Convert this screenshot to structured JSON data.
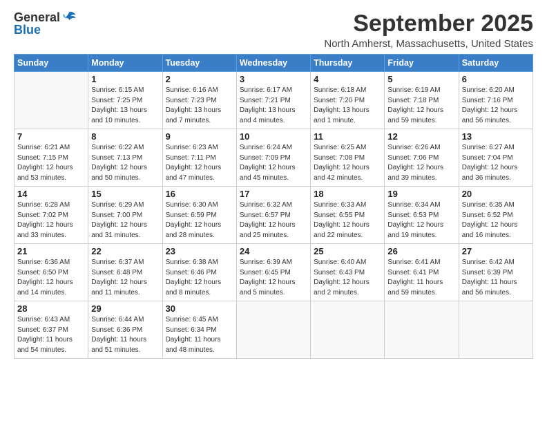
{
  "logo": {
    "general": "General",
    "blue": "Blue"
  },
  "title": "September 2025",
  "location": "North Amherst, Massachusetts, United States",
  "weekdays": [
    "Sunday",
    "Monday",
    "Tuesday",
    "Wednesday",
    "Thursday",
    "Friday",
    "Saturday"
  ],
  "weeks": [
    [
      {
        "day": "",
        "info": ""
      },
      {
        "day": "1",
        "info": "Sunrise: 6:15 AM\nSunset: 7:25 PM\nDaylight: 13 hours\nand 10 minutes."
      },
      {
        "day": "2",
        "info": "Sunrise: 6:16 AM\nSunset: 7:23 PM\nDaylight: 13 hours\nand 7 minutes."
      },
      {
        "day": "3",
        "info": "Sunrise: 6:17 AM\nSunset: 7:21 PM\nDaylight: 13 hours\nand 4 minutes."
      },
      {
        "day": "4",
        "info": "Sunrise: 6:18 AM\nSunset: 7:20 PM\nDaylight: 13 hours\nand 1 minute."
      },
      {
        "day": "5",
        "info": "Sunrise: 6:19 AM\nSunset: 7:18 PM\nDaylight: 12 hours\nand 59 minutes."
      },
      {
        "day": "6",
        "info": "Sunrise: 6:20 AM\nSunset: 7:16 PM\nDaylight: 12 hours\nand 56 minutes."
      }
    ],
    [
      {
        "day": "7",
        "info": "Sunrise: 6:21 AM\nSunset: 7:15 PM\nDaylight: 12 hours\nand 53 minutes."
      },
      {
        "day": "8",
        "info": "Sunrise: 6:22 AM\nSunset: 7:13 PM\nDaylight: 12 hours\nand 50 minutes."
      },
      {
        "day": "9",
        "info": "Sunrise: 6:23 AM\nSunset: 7:11 PM\nDaylight: 12 hours\nand 47 minutes."
      },
      {
        "day": "10",
        "info": "Sunrise: 6:24 AM\nSunset: 7:09 PM\nDaylight: 12 hours\nand 45 minutes."
      },
      {
        "day": "11",
        "info": "Sunrise: 6:25 AM\nSunset: 7:08 PM\nDaylight: 12 hours\nand 42 minutes."
      },
      {
        "day": "12",
        "info": "Sunrise: 6:26 AM\nSunset: 7:06 PM\nDaylight: 12 hours\nand 39 minutes."
      },
      {
        "day": "13",
        "info": "Sunrise: 6:27 AM\nSunset: 7:04 PM\nDaylight: 12 hours\nand 36 minutes."
      }
    ],
    [
      {
        "day": "14",
        "info": "Sunrise: 6:28 AM\nSunset: 7:02 PM\nDaylight: 12 hours\nand 33 minutes."
      },
      {
        "day": "15",
        "info": "Sunrise: 6:29 AM\nSunset: 7:00 PM\nDaylight: 12 hours\nand 31 minutes."
      },
      {
        "day": "16",
        "info": "Sunrise: 6:30 AM\nSunset: 6:59 PM\nDaylight: 12 hours\nand 28 minutes."
      },
      {
        "day": "17",
        "info": "Sunrise: 6:32 AM\nSunset: 6:57 PM\nDaylight: 12 hours\nand 25 minutes."
      },
      {
        "day": "18",
        "info": "Sunrise: 6:33 AM\nSunset: 6:55 PM\nDaylight: 12 hours\nand 22 minutes."
      },
      {
        "day": "19",
        "info": "Sunrise: 6:34 AM\nSunset: 6:53 PM\nDaylight: 12 hours\nand 19 minutes."
      },
      {
        "day": "20",
        "info": "Sunrise: 6:35 AM\nSunset: 6:52 PM\nDaylight: 12 hours\nand 16 minutes."
      }
    ],
    [
      {
        "day": "21",
        "info": "Sunrise: 6:36 AM\nSunset: 6:50 PM\nDaylight: 12 hours\nand 14 minutes."
      },
      {
        "day": "22",
        "info": "Sunrise: 6:37 AM\nSunset: 6:48 PM\nDaylight: 12 hours\nand 11 minutes."
      },
      {
        "day": "23",
        "info": "Sunrise: 6:38 AM\nSunset: 6:46 PM\nDaylight: 12 hours\nand 8 minutes."
      },
      {
        "day": "24",
        "info": "Sunrise: 6:39 AM\nSunset: 6:45 PM\nDaylight: 12 hours\nand 5 minutes."
      },
      {
        "day": "25",
        "info": "Sunrise: 6:40 AM\nSunset: 6:43 PM\nDaylight: 12 hours\nand 2 minutes."
      },
      {
        "day": "26",
        "info": "Sunrise: 6:41 AM\nSunset: 6:41 PM\nDaylight: 11 hours\nand 59 minutes."
      },
      {
        "day": "27",
        "info": "Sunrise: 6:42 AM\nSunset: 6:39 PM\nDaylight: 11 hours\nand 56 minutes."
      }
    ],
    [
      {
        "day": "28",
        "info": "Sunrise: 6:43 AM\nSunset: 6:37 PM\nDaylight: 11 hours\nand 54 minutes."
      },
      {
        "day": "29",
        "info": "Sunrise: 6:44 AM\nSunset: 6:36 PM\nDaylight: 11 hours\nand 51 minutes."
      },
      {
        "day": "30",
        "info": "Sunrise: 6:45 AM\nSunset: 6:34 PM\nDaylight: 11 hours\nand 48 minutes."
      },
      {
        "day": "",
        "info": ""
      },
      {
        "day": "",
        "info": ""
      },
      {
        "day": "",
        "info": ""
      },
      {
        "day": "",
        "info": ""
      }
    ]
  ]
}
